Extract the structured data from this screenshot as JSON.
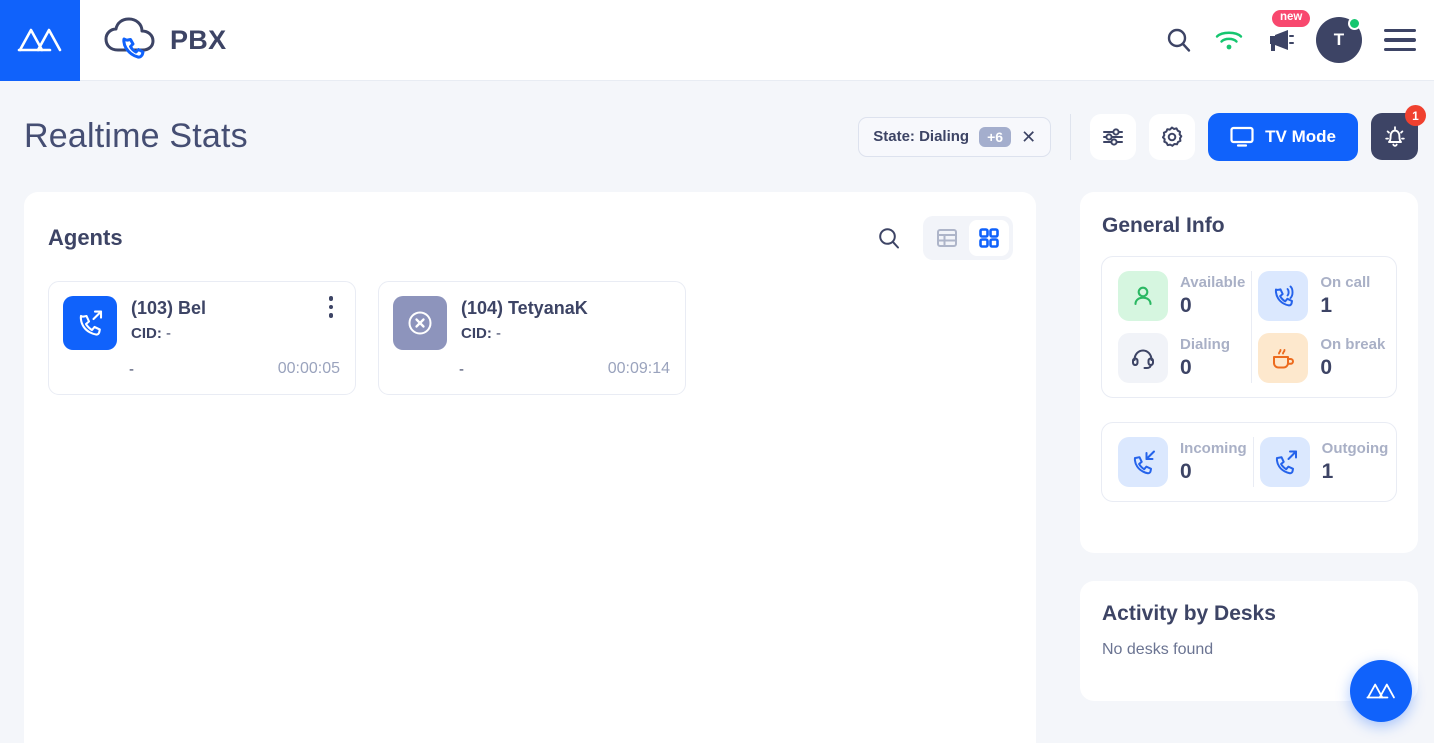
{
  "header": {
    "brand_logo": "amio-logo-icon",
    "cloud_icon": "cloud-phone-icon",
    "app_title": "PBX",
    "search_icon": "search-icon",
    "wifi_icon": "wifi-icon",
    "megaphone_icon": "megaphone-icon",
    "new_badge": "new",
    "avatar_initial": "T",
    "menu_icon": "hamburger-menu-icon"
  },
  "page": {
    "title": "Realtime Stats",
    "filter_chip": {
      "label": "State: Dialing",
      "count": "+6",
      "close": "✕"
    },
    "sliders_icon": "sliders-icon",
    "gear_icon": "gear-icon",
    "tv_mode_label": "TV Mode",
    "tv_icon": "monitor-icon",
    "bell_icon": "bell-icon",
    "bell_badge": "1"
  },
  "agents": {
    "title": "Agents",
    "search_icon": "search-icon",
    "view_list_icon": "list-view-icon",
    "view_grid_icon": "grid-view-icon",
    "active_view": "grid",
    "cards": [
      {
        "name": "(103) Bel",
        "cid_label": "CID:",
        "cid_value": "-",
        "status": "-",
        "timer": "00:00:05",
        "state_icon": "outgoing-call-icon",
        "icon_bg": "#1062fb",
        "icon_color": "#ffffff",
        "has_menu": true
      },
      {
        "name": "(104) TetyanaK",
        "cid_label": "CID:",
        "cid_value": "-",
        "status": "-",
        "timer": "00:09:14",
        "state_icon": "offline-x-circle-icon",
        "icon_bg": "#8d94bc",
        "icon_color": "#ffffff",
        "has_menu": false
      }
    ]
  },
  "general_info": {
    "title": "General Info",
    "stats_primary": [
      {
        "label": "Available",
        "value": "0",
        "icon": "user-icon",
        "icon_bg": "#d6f6e0",
        "icon_color": "#2bb863"
      },
      {
        "label": "On call",
        "value": "1",
        "icon": "ringing-phone-icon",
        "icon_bg": "#dbe8fe",
        "icon_color": "#2563eb"
      },
      {
        "label": "Dialing",
        "value": "0",
        "icon": "headset-icon",
        "icon_bg": "#f1f3f8",
        "icon_color": "#3d4465"
      },
      {
        "label": "On break",
        "value": "0",
        "icon": "coffee-cup-icon",
        "icon_bg": "#fde8cd",
        "icon_color": "#ec6b1e"
      }
    ],
    "stats_calls": [
      {
        "label": "Incoming",
        "value": "0",
        "icon": "incoming-call-icon",
        "icon_bg": "#dbe8fe",
        "icon_color": "#2563eb"
      },
      {
        "label": "Outgoing",
        "value": "1",
        "icon": "outgoing-call-icon",
        "icon_bg": "#dbe8fe",
        "icon_color": "#2563eb"
      }
    ]
  },
  "activity_by_desks": {
    "title": "Activity by Desks",
    "empty_text": "No desks found"
  },
  "fab": {
    "icon": "amio-logo-icon"
  },
  "colors": {
    "accent": "#1062fb",
    "dark": "#3d4465",
    "page_bg": "#f4f6fa",
    "danger": "#f0412f",
    "pink": "#f8486e",
    "green": "#16c670"
  }
}
